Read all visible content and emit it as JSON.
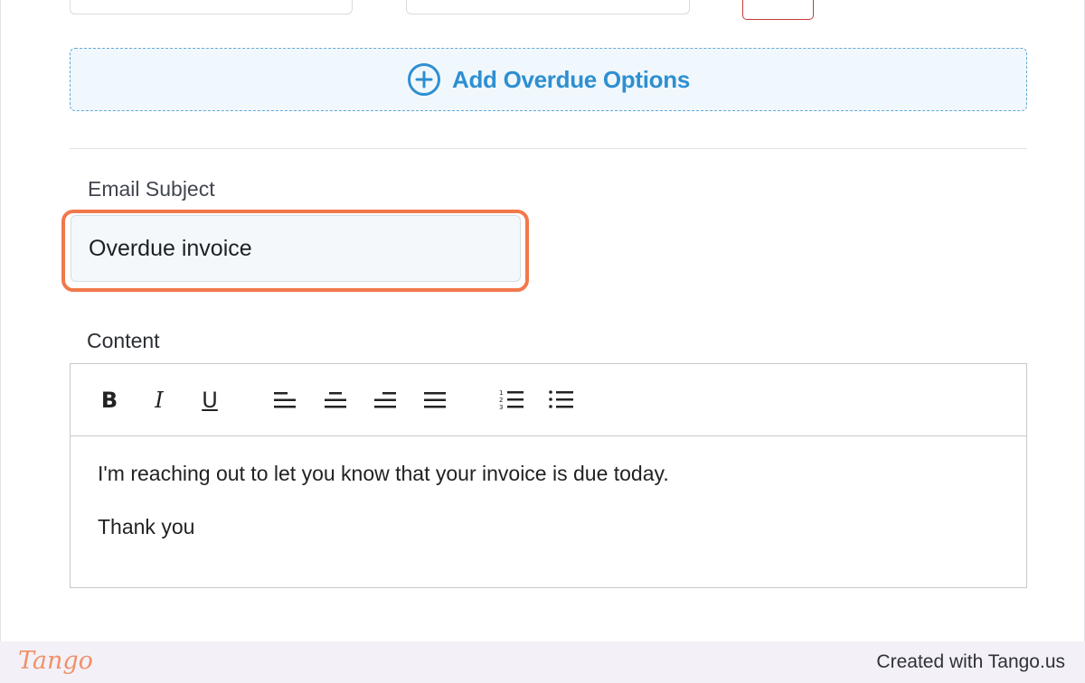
{
  "overdue": {
    "add_label": "Add Overdue Options"
  },
  "email": {
    "subject_label": "Email Subject",
    "subject_value": "Overdue invoice"
  },
  "content": {
    "label": "Content",
    "toolbar": {
      "bold": "B",
      "italic": "I",
      "underline": "U"
    },
    "paragraphs": [
      "I'm reaching out to let you know that your invoice is due today.",
      "Thank you"
    ]
  },
  "footer": {
    "logo": "Tango",
    "credit": "Created with Tango.us"
  },
  "colors": {
    "accent_blue": "#2e8fd1",
    "highlight_orange": "#f2784b",
    "danger_red": "#c63a3a"
  }
}
